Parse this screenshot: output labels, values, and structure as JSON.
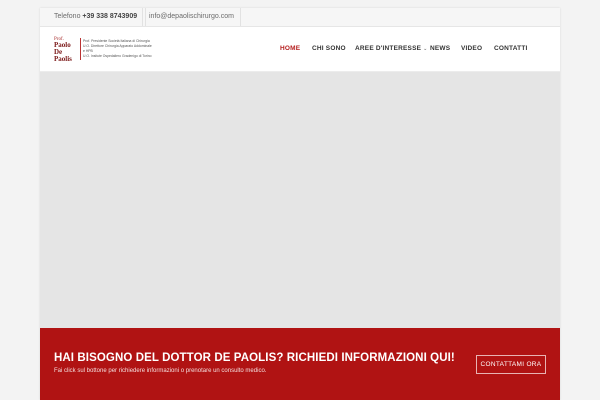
{
  "topbar": {
    "phone_label": "Telefono",
    "phone_number": "+39 338 8743909",
    "email": "info@depaolischirurgo.com"
  },
  "logo": {
    "prefix": "Prof.",
    "first_name": "Paolo",
    "last_name": "De Paolis",
    "description_lines": [
      "Prof. Presidente Società Italiana di Chirurgia",
      "U.O. Direttore Chirurgia Apparato Addominale e HPB",
      "U.O. Insitute Ospedaliero Gradenigo di Torino"
    ]
  },
  "nav": {
    "items": [
      {
        "label": "HOME",
        "active": true,
        "has_dropdown": false
      },
      {
        "label": "CHI SONO",
        "active": false,
        "has_dropdown": false
      },
      {
        "label": "AREE D'INTERESSE",
        "active": false,
        "has_dropdown": true
      },
      {
        "label": "NEWS",
        "active": false,
        "has_dropdown": false
      },
      {
        "label": "VIDEO",
        "active": false,
        "has_dropdown": false
      },
      {
        "label": "CONTATTI",
        "active": false,
        "has_dropdown": false
      }
    ]
  },
  "cta": {
    "title": "HAI BISOGNO DEL DOTTOR DE PAOLIS? RICHIEDI INFORMAZIONI QUI!",
    "subtitle": "Fai click sul bottone per richiedere informazioni o prenotare un consulto medico.",
    "button_label": "CONTATTAMI ORA"
  },
  "colors": {
    "accent": "#b01313",
    "active_nav": "#b41c1c",
    "hero_placeholder": "#e5e5e5"
  },
  "icons": {
    "dropdown": "chevron-down-icon"
  }
}
